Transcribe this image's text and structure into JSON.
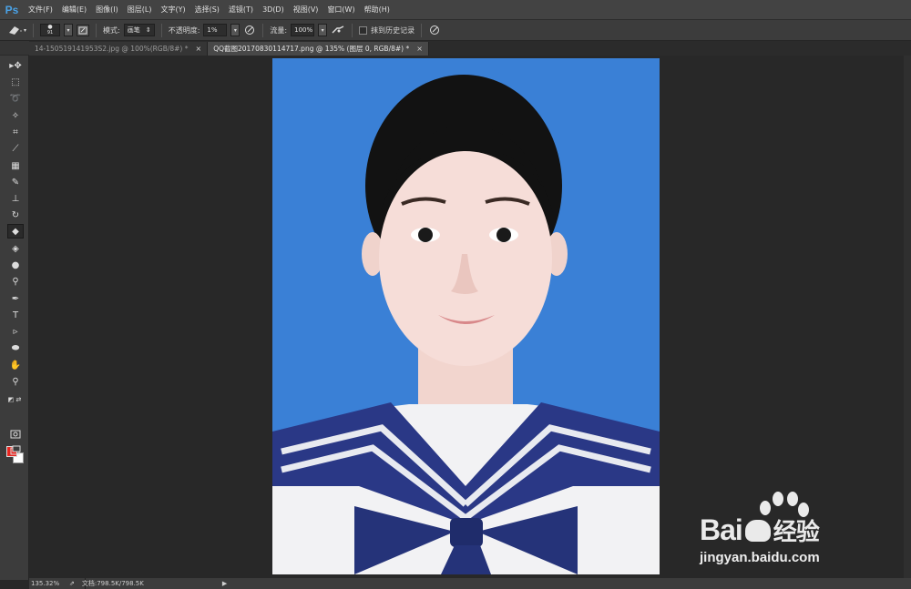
{
  "app": {
    "logo": "Ps"
  },
  "menu": [
    "文件(F)",
    "编辑(E)",
    "图像(I)",
    "图层(L)",
    "文字(Y)",
    "选择(S)",
    "滤镜(T)",
    "3D(D)",
    "视图(V)",
    "窗口(W)",
    "帮助(H)"
  ],
  "options": {
    "brush_size": "91",
    "mode_label": "模式:",
    "mode_value": "画笔",
    "opacity_label": "不透明度:",
    "opacity_value": "1%",
    "flow_label": "流量:",
    "flow_value": "100%",
    "erase_history_label": "抹到历史记录"
  },
  "tabs": [
    {
      "title": "14-150519141953S2.jpg @ 100%(RGB/8#) *",
      "close": "×",
      "active": false
    },
    {
      "title": "QQ截图20170830114717.png @ 135% (图层 0, RGB/8#) *",
      "close": "×",
      "active": true
    }
  ],
  "tools": [
    {
      "name": "move-tool-icon",
      "glyph": "▸✥"
    },
    {
      "name": "marquee-tool-icon",
      "glyph": "⬚"
    },
    {
      "name": "lasso-tool-icon",
      "glyph": "➰"
    },
    {
      "name": "magic-wand-tool-icon",
      "glyph": "✧"
    },
    {
      "name": "crop-tool-icon",
      "glyph": "⌗"
    },
    {
      "name": "eyedropper-tool-icon",
      "glyph": "⟋"
    },
    {
      "name": "healing-brush-tool-icon",
      "glyph": "▦"
    },
    {
      "name": "brush-tool-icon",
      "glyph": "✎"
    },
    {
      "name": "clone-stamp-tool-icon",
      "glyph": "⊥"
    },
    {
      "name": "history-brush-tool-icon",
      "glyph": "↻"
    },
    {
      "name": "eraser-tool-icon",
      "glyph": "◆"
    },
    {
      "name": "paint-bucket-tool-icon",
      "glyph": "◈"
    },
    {
      "name": "blur-tool-icon",
      "glyph": "●"
    },
    {
      "name": "dodge-tool-icon",
      "glyph": "⚲"
    },
    {
      "name": "pen-tool-icon",
      "glyph": "✒"
    },
    {
      "name": "type-tool-icon",
      "glyph": "T"
    },
    {
      "name": "path-selection-tool-icon",
      "glyph": "▹"
    },
    {
      "name": "ellipse-tool-icon",
      "glyph": "⬬"
    },
    {
      "name": "hand-tool-icon",
      "glyph": "✋"
    },
    {
      "name": "zoom-tool-icon",
      "glyph": "⚲"
    }
  ],
  "colors": {
    "foreground": "#e8251f",
    "background": "#ffffff",
    "photo_backdrop": "#3a80d6"
  },
  "status": {
    "zoom": "135.32%",
    "doc": "文档:798.5K/798.5K",
    "arrow": "▶"
  },
  "watermark": {
    "brand": "Bai",
    "brand_suffix": "经验",
    "url": "jingyan.baidu.com"
  }
}
